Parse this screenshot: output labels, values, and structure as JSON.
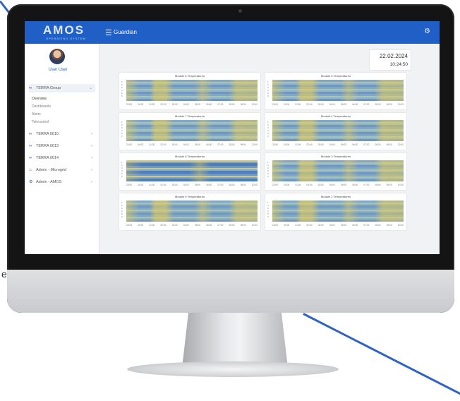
{
  "app": {
    "logo": "AMOS",
    "logo_sub": "OPERATING SYSTEM",
    "title": "Guardian"
  },
  "user": {
    "name": "User User"
  },
  "nav": {
    "group": "TERRA Group",
    "sub_items": [
      "Overview",
      "Dashboards",
      "Alerts",
      "Telecontrol"
    ],
    "items": [
      "TERRA 0010",
      "TERRA 0013",
      "TERRA 0014",
      "Admin - Microgrid",
      "Admin - AMOS"
    ]
  },
  "header": {
    "date": "22.02.2024",
    "time": "10:24:50"
  },
  "cards": [
    {
      "title": "Module 6 Temperatures"
    },
    {
      "title": "Module 5 Temperatures"
    },
    {
      "title": "Module 7 Temperatures"
    },
    {
      "title": "Module 4 Temperatures"
    },
    {
      "title": "Module 8 Temperatures"
    },
    {
      "title": "Module 3 Temperatures"
    },
    {
      "title": "Module 9 Temperatures"
    },
    {
      "title": "Module 2 Temperatures"
    }
  ],
  "x_ticks": [
    "23:00",
    "00:00",
    "01:00",
    "02:00",
    "03:00",
    "04:00",
    "05:00",
    "06:00",
    "07:00",
    "08:00",
    "09:00",
    "10:00"
  ],
  "y_ticks": [
    "1",
    "2",
    "3",
    "4",
    "5",
    "6"
  ],
  "stray_text": "e",
  "colors": {
    "brand": "#1f5fc6",
    "accent_line": "#2f62c8"
  },
  "icons": {
    "menu": "menu-icon",
    "settings": "gear-icon",
    "group": "link-icon",
    "admin_microgrid": "home-icon",
    "admin_amos": "gear-icon"
  }
}
